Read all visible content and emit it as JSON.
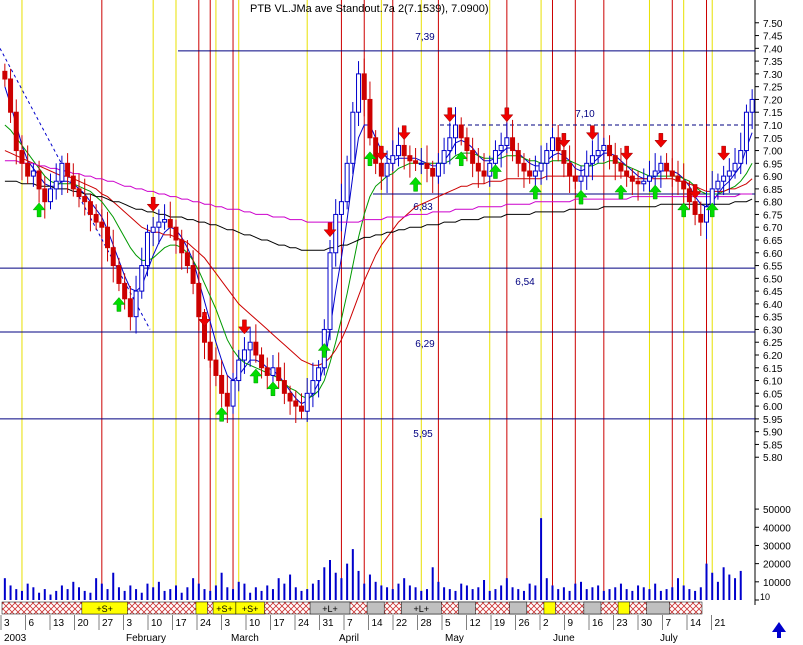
{
  "title_label": "PTB VL.JMa ave Standout.7a 2(7.1539), 7.0900)",
  "chart_data": {
    "type": "candlestick",
    "ylim": [
      5.75,
      7.55
    ],
    "y_ticks": [
      "7.50",
      "7.45",
      "7.40",
      "7.35",
      "7.30",
      "7.25",
      "7.20",
      "7.15",
      "7.10",
      "7.05",
      "7.00",
      "6.95",
      "6.90",
      "6.85",
      "6.80",
      "6.75",
      "6.70",
      "6.65",
      "6.60",
      "6.55",
      "6.50",
      "6.45",
      "6.40",
      "6.35",
      "6.30",
      "6.25",
      "6.20",
      "6.15",
      "6.10",
      "6.05",
      "6.00",
      "5.95",
      "5.90",
      "5.85",
      "5.80"
    ],
    "volume_ticks": [
      "50000",
      "40000",
      "30000",
      "20000",
      "10000",
      "0"
    ],
    "volume_ylim": [
      0,
      55000
    ],
    "x_day_labels": [
      "3",
      "6",
      "13",
      "20",
      "27",
      "3",
      "10",
      "17",
      "24",
      "3",
      "10",
      "17",
      "24",
      "31",
      "7",
      "14",
      "22",
      "28",
      "5",
      "12",
      "19",
      "26",
      "2",
      "9",
      "16",
      "23",
      "30",
      "7",
      "14",
      "21"
    ],
    "x_month_labels": [
      "2003",
      "February",
      "March",
      "April",
      "May",
      "June",
      "July"
    ],
    "level_lines": [
      {
        "value": 7.39,
        "label": "7,39"
      },
      {
        "value": 7.1,
        "label": "7,10"
      },
      {
        "value": 6.83,
        "label": "6,83"
      },
      {
        "value": 6.54,
        "label": "6,54"
      },
      {
        "value": 6.29,
        "label": "6,29"
      },
      {
        "value": 5.95,
        "label": "5,95"
      }
    ],
    "close": [
      7.28,
      7.15,
      7.0,
      6.95,
      6.9,
      6.92,
      6.85,
      6.8,
      6.85,
      6.88,
      6.95,
      6.9,
      6.85,
      6.82,
      6.8,
      6.75,
      6.72,
      6.7,
      6.62,
      6.55,
      6.48,
      6.42,
      6.35,
      6.45,
      6.55,
      6.68,
      6.7,
      6.72,
      6.73,
      6.7,
      6.65,
      6.6,
      6.55,
      6.48,
      6.35,
      6.25,
      6.18,
      6.12,
      6.05,
      6.0,
      6.1,
      6.18,
      6.22,
      6.25,
      6.2,
      6.15,
      6.12,
      6.15,
      6.1,
      6.05,
      6.02,
      6.0,
      5.98,
      6.05,
      6.1,
      6.15,
      6.3,
      6.6,
      6.75,
      6.8,
      6.95,
      7.15,
      7.3,
      7.2,
      7.05,
      6.95,
      6.9,
      6.95,
      6.98,
      7.02,
      6.98,
      6.96,
      6.95,
      6.95,
      6.93,
      6.9,
      6.95,
      7.0,
      7.05,
      7.1,
      7.05,
      7.0,
      6.95,
      6.92,
      6.9,
      6.95,
      7.0,
      7.02,
      7.05,
      7.0,
      6.95,
      6.92,
      6.9,
      6.92,
      6.95,
      7.0,
      7.05,
      7.0,
      6.95,
      6.9,
      6.88,
      6.9,
      6.95,
      6.98,
      7.0,
      7.02,
      6.98,
      6.95,
      6.92,
      6.9,
      6.88,
      6.87,
      6.88,
      6.9,
      6.92,
      6.95,
      6.92,
      6.9,
      6.88,
      6.85,
      6.8,
      6.75,
      6.72,
      6.78,
      6.85,
      6.88,
      6.9,
      6.92,
      6.95,
      7.0,
      7.15,
      7.2
    ],
    "volume": [
      12000,
      8000,
      6000,
      5000,
      9000,
      7000,
      4000,
      6000,
      3000,
      5000,
      8000,
      6000,
      10000,
      7000,
      5000,
      4000,
      12000,
      9000,
      6000,
      15000,
      7000,
      5000,
      8000,
      6000,
      4000,
      9000,
      7000,
      10000,
      5000,
      6000,
      8000,
      4000,
      7000,
      12000,
      9000,
      6000,
      5000,
      8000,
      15000,
      7000,
      6000,
      10000,
      9000,
      4000,
      7000,
      5000,
      8000,
      6000,
      12000,
      9000,
      14000,
      7000,
      5000,
      6000,
      9000,
      11000,
      18000,
      22000,
      15000,
      12000,
      20000,
      28000,
      16000,
      9000,
      14000,
      10000,
      8000,
      7000,
      6000,
      9000,
      12000,
      8000,
      7000,
      5000,
      6000,
      18000,
      10000,
      7000,
      6000,
      5000,
      9000,
      8000,
      6000,
      7000,
      11000,
      5000,
      6000,
      8000,
      12000,
      7000,
      6000,
      5000,
      9000,
      8000,
      45000,
      12000,
      8000,
      6000,
      7000,
      5000,
      9000,
      10000,
      6000,
      7000,
      8000,
      5000,
      6000,
      7000,
      9000,
      6000,
      5000,
      8000,
      7000,
      6000,
      9000,
      5000,
      6000,
      7000,
      12000,
      8000,
      6000,
      5000,
      7000,
      20000,
      15000,
      10000,
      18000,
      14000,
      12000,
      16000
    ],
    "ma_series": [
      {
        "color": "#0000cc",
        "values": [
          7.25,
          7.18,
          7.1,
          7.02,
          6.96,
          6.93,
          6.9,
          6.87,
          6.86,
          6.86,
          6.88,
          6.88,
          6.87,
          6.85,
          6.83,
          6.8,
          6.77,
          6.74,
          6.69,
          6.63,
          6.57,
          6.51,
          6.46,
          6.45,
          6.47,
          6.53,
          6.59,
          6.64,
          6.68,
          6.7,
          6.69,
          6.66,
          6.62,
          6.57,
          6.49,
          6.41,
          6.33,
          6.25,
          6.18,
          6.12,
          6.1,
          6.12,
          6.15,
          6.18,
          6.18,
          6.17,
          6.15,
          6.14,
          6.12,
          6.09,
          6.06,
          6.03,
          6.01,
          6.02,
          6.05,
          6.09,
          6.16,
          6.3,
          6.45,
          6.58,
          6.73,
          6.9,
          7.05,
          7.1,
          7.1,
          7.05,
          7.0,
          6.97,
          6.96,
          6.97,
          6.97,
          6.97,
          6.97,
          6.96,
          6.95,
          6.94,
          6.94,
          6.96,
          6.99,
          7.03,
          7.04,
          7.03,
          7.01,
          6.98,
          6.96,
          6.96,
          6.97,
          6.99,
          7.01,
          7.01,
          6.99,
          6.97,
          6.95,
          6.94,
          6.94,
          6.96,
          6.98,
          6.99,
          6.98,
          6.96,
          6.93,
          6.92,
          6.93,
          6.95,
          6.97,
          6.99,
          6.99,
          6.98,
          6.96,
          6.94,
          6.92,
          6.9,
          6.89,
          6.89,
          6.9,
          6.92,
          6.92,
          6.92,
          6.91,
          6.89,
          6.86,
          6.82,
          6.79,
          6.78,
          6.8,
          6.83,
          6.86,
          6.88,
          6.91,
          6.94,
          7.01,
          7.07
        ]
      },
      {
        "color": "#009900",
        "values": [
          7.1,
          7.08,
          7.05,
          7.02,
          6.99,
          6.96,
          6.93,
          6.9,
          6.88,
          6.87,
          6.87,
          6.87,
          6.87,
          6.86,
          6.85,
          6.84,
          6.82,
          6.8,
          6.77,
          6.74,
          6.7,
          6.66,
          6.62,
          6.59,
          6.57,
          6.57,
          6.58,
          6.6,
          6.62,
          6.63,
          6.63,
          6.62,
          6.6,
          6.57,
          6.53,
          6.48,
          6.43,
          6.38,
          6.32,
          6.26,
          6.22,
          6.19,
          6.17,
          6.16,
          6.15,
          6.14,
          6.13,
          6.12,
          6.11,
          6.09,
          6.07,
          6.06,
          6.04,
          6.03,
          6.04,
          6.06,
          6.1,
          6.17,
          6.25,
          6.34,
          6.44,
          6.55,
          6.66,
          6.75,
          6.82,
          6.86,
          6.88,
          6.9,
          6.91,
          6.93,
          6.94,
          6.95,
          6.95,
          6.95,
          6.95,
          6.95,
          6.95,
          6.95,
          6.96,
          6.98,
          6.99,
          6.99,
          6.99,
          6.98,
          6.97,
          6.97,
          6.97,
          6.97,
          6.98,
          6.98,
          6.98,
          6.97,
          6.96,
          6.96,
          6.95,
          6.95,
          6.96,
          6.96,
          6.96,
          6.96,
          6.95,
          6.94,
          6.94,
          6.94,
          6.95,
          6.95,
          6.96,
          6.96,
          6.95,
          6.94,
          6.93,
          6.92,
          6.91,
          6.9,
          6.9,
          6.9,
          6.9,
          6.9,
          6.9,
          6.89,
          6.88,
          6.86,
          6.84,
          6.83,
          6.83,
          6.83,
          6.84,
          6.85,
          6.86,
          6.88,
          6.91,
          6.95
        ]
      },
      {
        "color": "#cc0000",
        "values": [
          7.0,
          6.99,
          6.98,
          6.97,
          6.96,
          6.95,
          6.94,
          6.93,
          6.92,
          6.91,
          6.9,
          6.9,
          6.89,
          6.88,
          6.87,
          6.86,
          6.85,
          6.83,
          6.82,
          6.8,
          6.78,
          6.76,
          6.74,
          6.72,
          6.7,
          6.69,
          6.68,
          6.68,
          6.67,
          6.67,
          6.66,
          6.65,
          6.64,
          6.62,
          6.6,
          6.58,
          6.55,
          6.52,
          6.49,
          6.46,
          6.43,
          6.4,
          6.38,
          6.36,
          6.34,
          6.32,
          6.3,
          6.28,
          6.26,
          6.24,
          6.22,
          6.2,
          6.18,
          6.17,
          6.16,
          6.16,
          6.17,
          6.19,
          6.22,
          6.26,
          6.31,
          6.37,
          6.43,
          6.49,
          6.54,
          6.59,
          6.63,
          6.66,
          6.69,
          6.72,
          6.74,
          6.76,
          6.78,
          6.79,
          6.8,
          6.81,
          6.82,
          6.83,
          6.84,
          6.85,
          6.86,
          6.86,
          6.87,
          6.87,
          6.87,
          6.88,
          6.88,
          6.88,
          6.89,
          6.89,
          6.89,
          6.89,
          6.89,
          6.89,
          6.89,
          6.9,
          6.9,
          6.9,
          6.9,
          6.9,
          6.9,
          6.9,
          6.9,
          6.9,
          6.9,
          6.9,
          6.9,
          6.9,
          6.9,
          6.9,
          6.89,
          6.89,
          6.89,
          6.89,
          6.89,
          6.89,
          6.89,
          6.89,
          6.88,
          6.88,
          6.87,
          6.86,
          6.85,
          6.84,
          6.84,
          6.84,
          6.84,
          6.85,
          6.85,
          6.86,
          6.87,
          6.89
        ]
      },
      {
        "color": "#000000",
        "values": [
          6.88,
          6.88,
          6.88,
          6.87,
          6.87,
          6.87,
          6.86,
          6.86,
          6.86,
          6.85,
          6.85,
          6.85,
          6.84,
          6.84,
          6.83,
          6.83,
          6.82,
          6.82,
          6.81,
          6.8,
          6.8,
          6.79,
          6.78,
          6.77,
          6.77,
          6.76,
          6.76,
          6.75,
          6.75,
          6.74,
          6.74,
          6.74,
          6.73,
          6.73,
          6.72,
          6.72,
          6.71,
          6.71,
          6.7,
          6.69,
          6.69,
          6.68,
          6.67,
          6.67,
          6.66,
          6.65,
          6.65,
          6.64,
          6.63,
          6.63,
          6.62,
          6.62,
          6.61,
          6.61,
          6.61,
          6.61,
          6.61,
          6.62,
          6.62,
          6.63,
          6.63,
          6.64,
          6.65,
          6.66,
          6.66,
          6.67,
          6.67,
          6.68,
          6.68,
          6.69,
          6.69,
          6.7,
          6.7,
          6.7,
          6.71,
          6.71,
          6.71,
          6.72,
          6.72,
          6.72,
          6.73,
          6.73,
          6.73,
          6.73,
          6.74,
          6.74,
          6.74,
          6.74,
          6.75,
          6.75,
          6.75,
          6.75,
          6.75,
          6.76,
          6.76,
          6.76,
          6.76,
          6.76,
          6.76,
          6.77,
          6.77,
          6.77,
          6.77,
          6.77,
          6.77,
          6.78,
          6.78,
          6.78,
          6.78,
          6.78,
          6.78,
          6.78,
          6.78,
          6.78,
          6.78,
          6.79,
          6.79,
          6.79,
          6.79,
          6.79,
          6.79,
          6.79,
          6.79,
          6.79,
          6.79,
          6.79,
          6.79,
          6.79,
          6.8,
          6.8,
          6.8,
          6.81
        ]
      },
      {
        "color": "#cc00cc",
        "values": [
          6.96,
          6.96,
          6.96,
          6.95,
          6.95,
          6.95,
          6.94,
          6.94,
          6.93,
          6.93,
          6.92,
          6.92,
          6.91,
          6.91,
          6.9,
          6.9,
          6.89,
          6.89,
          6.88,
          6.88,
          6.87,
          6.86,
          6.86,
          6.85,
          6.85,
          6.84,
          6.84,
          6.83,
          6.83,
          6.82,
          6.82,
          6.81,
          6.81,
          6.8,
          6.8,
          6.79,
          6.79,
          6.78,
          6.78,
          6.77,
          6.77,
          6.77,
          6.76,
          6.76,
          6.75,
          6.75,
          6.75,
          6.74,
          6.74,
          6.74,
          6.73,
          6.73,
          6.73,
          6.72,
          6.72,
          6.72,
          6.72,
          6.72,
          6.72,
          6.72,
          6.72,
          6.72,
          6.72,
          6.73,
          6.73,
          6.73,
          6.73,
          6.74,
          6.74,
          6.74,
          6.74,
          6.75,
          6.75,
          6.75,
          6.75,
          6.76,
          6.76,
          6.76,
          6.76,
          6.77,
          6.77,
          6.77,
          6.77,
          6.78,
          6.78,
          6.78,
          6.78,
          6.78,
          6.79,
          6.79,
          6.79,
          6.79,
          6.79,
          6.8,
          6.8,
          6.8,
          6.8,
          6.8,
          6.8,
          6.8,
          6.81,
          6.81,
          6.81,
          6.81,
          6.81,
          6.81,
          6.81,
          6.81,
          6.81,
          6.81,
          6.82,
          6.82,
          6.82,
          6.82,
          6.82,
          6.82,
          6.82,
          6.82,
          6.82,
          6.82,
          6.82,
          6.82,
          6.82,
          6.82,
          6.82,
          6.82,
          6.82,
          6.82,
          6.82,
          6.83,
          6.83,
          6.83
        ]
      }
    ],
    "buy_arrows": [
      6,
      20,
      38,
      44,
      47,
      56,
      64,
      72,
      80,
      86,
      93,
      101,
      108,
      114,
      119,
      124
    ],
    "sell_arrows": [
      26,
      35,
      42,
      57,
      66,
      70,
      78,
      88,
      98,
      103,
      109,
      115,
      121,
      126
    ],
    "red_vlines": [
      17,
      34,
      36,
      40,
      59,
      63,
      68,
      76,
      88,
      96,
      100,
      105,
      117,
      123
    ],
    "yellow_vlines": [
      3,
      26,
      30,
      37,
      41,
      53,
      66,
      73,
      85,
      94,
      113,
      119,
      124
    ],
    "signal_band": [
      {
        "label": "+S+",
        "start": 14,
        "end": 21,
        "kind": "yellow"
      },
      {
        "label": "",
        "start": 34,
        "end": 35,
        "kind": "yellow"
      },
      {
        "label": "+S+",
        "start": 37,
        "end": 40,
        "kind": "yellow"
      },
      {
        "label": "+S+",
        "start": 41,
        "end": 45,
        "kind": "yellow"
      },
      {
        "label": "+L+",
        "start": 54,
        "end": 60,
        "kind": "gray"
      },
      {
        "label": "",
        "start": 64,
        "end": 66,
        "kind": "gray"
      },
      {
        "label": "+L+",
        "start": 70,
        "end": 76,
        "kind": "gray"
      },
      {
        "label": "",
        "start": 80,
        "end": 82,
        "kind": "gray"
      },
      {
        "label": "",
        "start": 89,
        "end": 91,
        "kind": "gray"
      },
      {
        "label": "",
        "start": 95,
        "end": 96,
        "kind": "yellow"
      },
      {
        "label": "",
        "start": 102,
        "end": 104,
        "kind": "gray"
      },
      {
        "label": "",
        "start": 108,
        "end": 109,
        "kind": "yellow"
      },
      {
        "label": "",
        "start": 113,
        "end": 116,
        "kind": "gray"
      }
    ],
    "volume_marker": "10"
  }
}
